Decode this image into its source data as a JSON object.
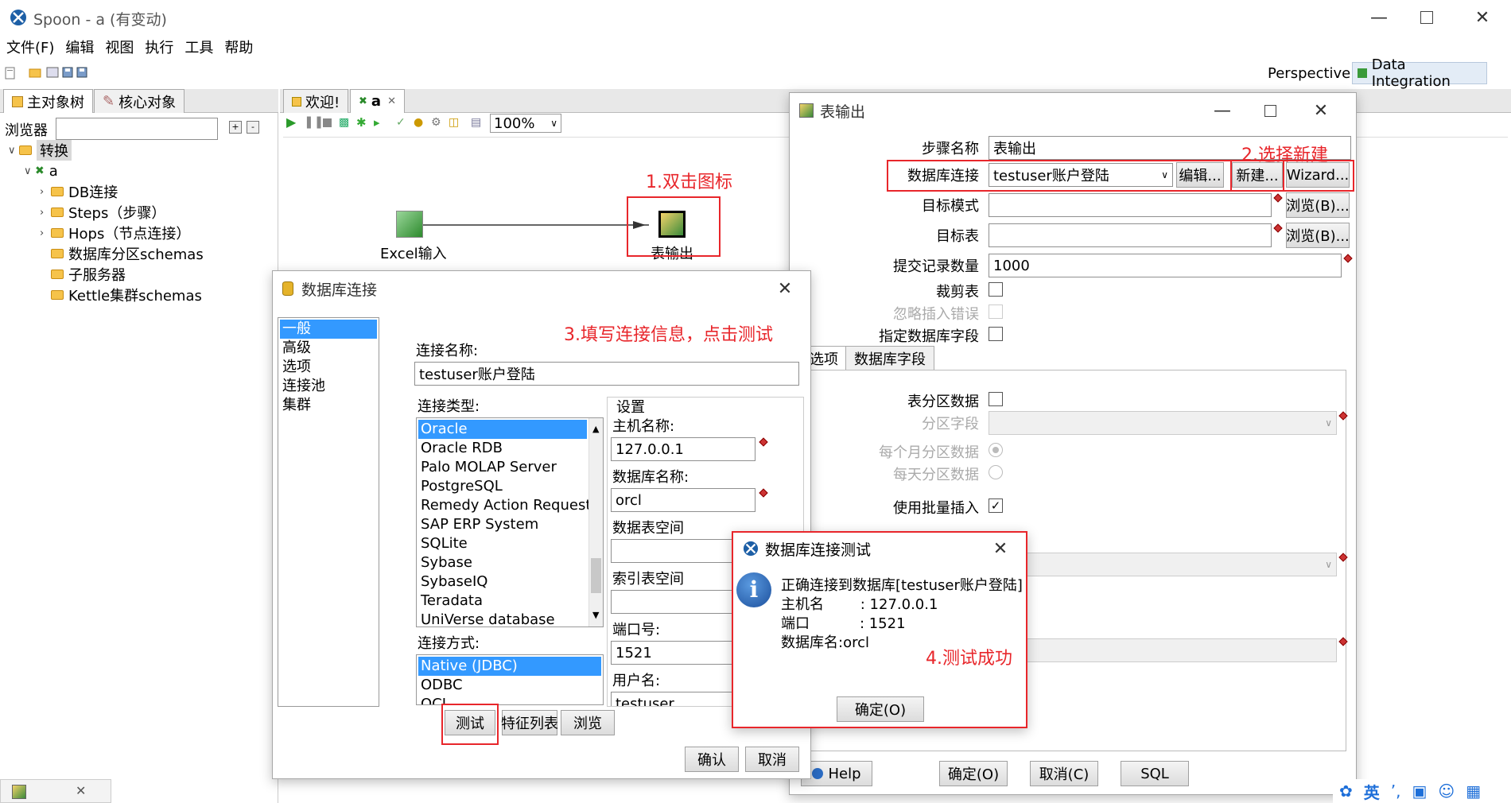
{
  "app": {
    "title": "Spoon - a (有变动)"
  },
  "menu": [
    "文件(F)",
    "编辑",
    "视图",
    "执行",
    "工具",
    "帮助"
  ],
  "perspective": {
    "label": "Perspective:",
    "value": "Data Integration"
  },
  "left_panel": {
    "tabs": [
      "主对象树",
      "核心对象"
    ],
    "browser_label": "浏览器",
    "tree": {
      "root": "转换",
      "trans": "a",
      "children": [
        "DB连接",
        "Steps（步骤）",
        "Hops（节点连接）",
        "数据库分区schemas",
        "子服务器",
        "Kettle集群schemas"
      ]
    }
  },
  "editor": {
    "tabs": [
      "欢迎!",
      "a"
    ],
    "zoom": "100%",
    "steps": {
      "excel": "Excel输入",
      "output": "表输出"
    }
  },
  "annotations": {
    "n1": "1.双击图标",
    "n2": "2.选择新建",
    "n3": "3.填写连接信息，点击测试",
    "n4": "4.测试成功"
  },
  "table_output": {
    "title": "表输出",
    "step_name_label": "步骤名称",
    "step_name": "表输出",
    "db_conn_label": "数据库连接",
    "db_conn_value": "testuser账户登陆",
    "edit_btn": "编辑...",
    "new_btn": "新建...",
    "wizard_btn": "Wizard...",
    "schema_label": "目标模式",
    "table_label": "目标表",
    "browse_btn": "浏览(B)...",
    "commit_label": "提交记录数量",
    "commit_value": "1000",
    "truncate_label": "裁剪表",
    "ignore_label": "忽略插入错误",
    "specify_label": "指定数据库字段",
    "tabs": [
      "选项",
      "数据库字段"
    ],
    "partition_label": "表分区数据",
    "partition_field_label": "分区字段",
    "monthly_label": "每个月分区数据",
    "daily_label": "每天分区数据",
    "batch_label": "使用批量插入",
    "help_btn": "Help",
    "ok_btn": "确定(O)",
    "cancel_btn": "取消(C)",
    "sql_btn": "SQL"
  },
  "db_conn": {
    "title": "数据库连接",
    "nav": [
      "一般",
      "高级",
      "选项",
      "连接池",
      "集群"
    ],
    "conn_name_label": "连接名称:",
    "conn_name": "testuser账户登陆",
    "conn_type_label": "连接类型:",
    "types": [
      "Oracle",
      "Oracle RDB",
      "Palo MOLAP Server",
      "PostgreSQL",
      "Remedy Action Request",
      "SAP ERP System",
      "SQLite",
      "Sybase",
      "SybaseIQ",
      "Teradata",
      "UniVerse database"
    ],
    "access_label": "连接方式:",
    "access": [
      "Native (JDBC)",
      "ODBC",
      "OCI"
    ],
    "settings_label": "设置",
    "host_label": "主机名称:",
    "host": "127.0.0.1",
    "dbname_label": "数据库名称:",
    "dbname": "orcl",
    "tablespace_label": "数据表空间",
    "index_tablespace_label": "索引表空间",
    "port_label": "端口号:",
    "port": "1521",
    "user_label": "用户名:",
    "user": "testuser",
    "test_btn": "测试",
    "features_btn": "特征列表",
    "explore_btn": "浏览",
    "ok_btn": "确认",
    "cancel_btn": "取消"
  },
  "test_dialog": {
    "title": "数据库连接测试",
    "line1": "正确连接到数据库[testuser账户登陆]",
    "line2": "主机名        : 127.0.0.1",
    "line3": "端口           : 1521",
    "line4": "数据库名:orcl",
    "ok_btn": "确定(O)"
  },
  "taskbar": {
    "ime": "英"
  }
}
